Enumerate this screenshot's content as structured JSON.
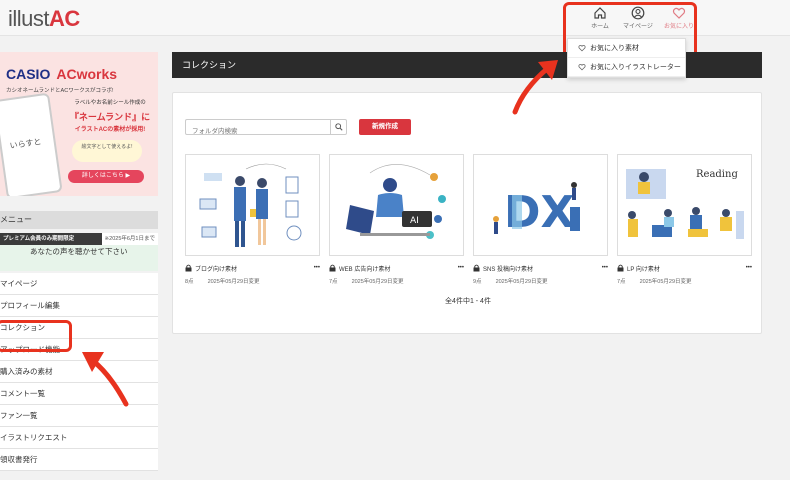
{
  "header": {
    "logo_text": "illust",
    "logo_accent": "AC",
    "nav": {
      "home": "ホーム",
      "mypage": "マイページ",
      "favorite": "お気に入り"
    }
  },
  "dropdown": {
    "items": [
      "お気に入り素材",
      "お気に入りイラストレーター"
    ]
  },
  "sidebar": {
    "banner": {
      "brand": "CASIO",
      "brand_accent": "ACworks",
      "subtitle": "カシオネームランドとACワークスがコラボ!",
      "line1": "ラベルやお名前シール作成の",
      "line2": "『ネームランド』に",
      "line3": "イラストACの素材が採用!",
      "bubble": "絵文字として使えるよ!",
      "phone_text": "いらすと",
      "cta": "詳しくはこちら ▶"
    },
    "menu_title": "メニュー",
    "premium_label": "プレミアム会員のみ期間限定",
    "premium_date": "※2025年6月1日まで",
    "voice": "あなたの声を聴かせて下さい",
    "items": [
      "マイページ",
      "プロフィール編集",
      "コレクション",
      "アップロード機能",
      "購入済みの素材",
      "コメント一覧",
      "ファン一覧",
      "イラストリクエスト",
      "領収書発行"
    ]
  },
  "main": {
    "title": "コレクション",
    "search_placeholder": "フォルダ内検索",
    "new_button": "新規作成",
    "cards": [
      {
        "name": "ブログ向け素材",
        "count": "8点",
        "updated": "2025年05月29日変更"
      },
      {
        "name": "WEB 広告向け素材",
        "count": "7点",
        "updated": "2025年05月29日変更"
      },
      {
        "name": "SNS 投稿向け素材",
        "count": "9点",
        "updated": "2025年05月29日変更"
      },
      {
        "name": "LP 向け素材",
        "count": "7点",
        "updated": "2025年05月29日変更"
      }
    ],
    "thumb_texts": {
      "ai": "AI",
      "dx": "DX",
      "reading": "Reading"
    },
    "pager": "全4件中1 - 4件"
  },
  "colors": {
    "accent": "#d9363e",
    "annotation": "#e8321e",
    "header_dark": "#2b2b2b"
  }
}
